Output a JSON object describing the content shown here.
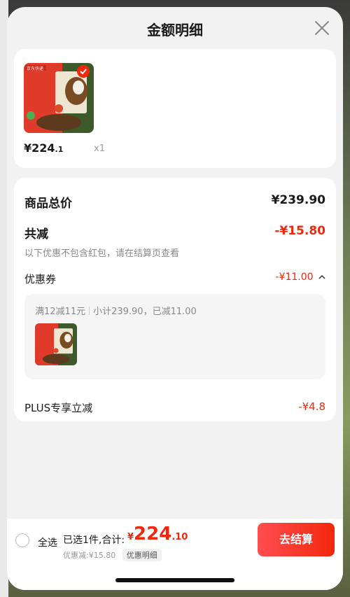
{
  "header": {
    "title": "金额明细"
  },
  "product": {
    "price_main": "¥224",
    "price_decimal": ".1",
    "quantity": "x1",
    "image_label": "京东快递"
  },
  "detail": {
    "total_label": "商品总价",
    "total_value": "¥239.90",
    "reduce_label": "共减",
    "reduce_value": "-¥15.80",
    "reduce_note": "以下优惠不包含红包，请在结算页查看",
    "coupon_label": "优惠券",
    "coupon_value": "-¥11.00",
    "coupon_rule": "满12减11元",
    "coupon_subtotal": "小计239.90，已减11.00",
    "plus_label": "PLUS专享立减",
    "plus_value": "-¥4.8"
  },
  "bottom": {
    "select_all": "全选",
    "selected_text": "已选1件,合计:",
    "currency": "¥",
    "total_int": "224",
    "total_dec": ".10",
    "discount_text": "优惠减:¥15.80",
    "detail_chip": "优惠明细",
    "checkout_label": "去结算"
  },
  "colors": {
    "accent": "#f2270c",
    "background": "#f2f2f2"
  }
}
